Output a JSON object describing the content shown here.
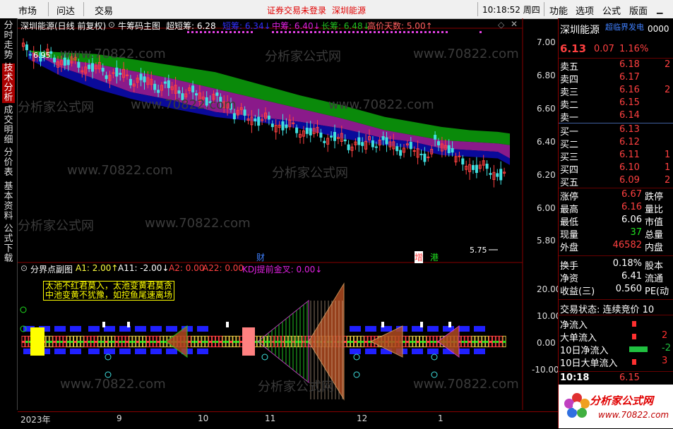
{
  "menubar": {
    "items": [
      "市场",
      "问达",
      "交易"
    ],
    "notice": "证券交易未登录",
    "stock_link": "深圳能源",
    "clock": "10:18:52 周四",
    "right_items": [
      "功能",
      "选项",
      "公式",
      "版面"
    ],
    "icons": [
      "minimize-icon",
      "maximize-icon",
      "close-icon"
    ]
  },
  "left_tabs": [
    {
      "label": "分时走势",
      "active": false
    },
    {
      "label": "技术分析",
      "active": true
    },
    {
      "label": "成交明细",
      "active": false
    },
    {
      "label": "分价表",
      "active": false
    },
    {
      "label": "基本资料",
      "active": false
    },
    {
      "label": "公式下载",
      "active": false
    }
  ],
  "main_chart": {
    "stock_name": "深圳能源(日线 前复权)",
    "indicator": "牛筹码主图",
    "params": [
      {
        "label": "超短筹: 6.28",
        "color": "#ffffff"
      },
      {
        "label": "短筹: 6.34↓",
        "color": "#3030ff"
      },
      {
        "label": "中筹: 6.40↓",
        "color": "#e020e0"
      },
      {
        "label": "长筹: 6.48↓",
        "color": "#20c020"
      },
      {
        "label": "高价天数: 5.00↑",
        "color": "#ff6060"
      }
    ],
    "y_ticks": [
      "7.00",
      "6.80",
      "6.60",
      "6.40",
      "6.20",
      "6.00",
      "5.80"
    ],
    "high_label": "6.95",
    "low_label": "5.75",
    "markers": [
      {
        "label": "财",
        "color": "#4080ff"
      },
      {
        "label": "增",
        "color": "#ff4040"
      },
      {
        "label": "港",
        "color": "#20e020"
      }
    ],
    "watermarks": [
      "分析家公式网",
      "www.70822.com"
    ]
  },
  "sub_chart": {
    "indicator": "分界点副图",
    "params": [
      {
        "label": "A1: 2.00↑",
        "color": "#ffff40"
      },
      {
        "label": "A11: -2.00↓",
        "color": "#ffffff"
      },
      {
        "label": "A2: 0.00",
        "color": "#ff4040"
      },
      {
        "label": "A22: 0.00",
        "color": "#ff4040"
      },
      {
        "label": "KDJ提前金叉: 0.00↓",
        "color": "#e020e0"
      }
    ],
    "note_lines": [
      "太池不红君莫入，太池变黄君莫贪",
      "中池变黄不犹豫，如控鱼尾速离场"
    ],
    "y_ticks": [
      "20.00",
      "10.00",
      "0.00",
      "-10.00"
    ]
  },
  "date_axis": [
    "2023年",
    "9",
    "10",
    "11",
    "12",
    "1"
  ],
  "right_panel": {
    "name": "深圳能源",
    "tag": "超临界发电",
    "code": "0000",
    "price": "6.13",
    "change": "0.07",
    "change_pct": "1.16%",
    "sell": [
      {
        "label": "卖五",
        "price": "6.18",
        "vol": "2"
      },
      {
        "label": "卖四",
        "price": "6.17",
        "vol": ""
      },
      {
        "label": "卖三",
        "price": "6.16",
        "vol": "2"
      },
      {
        "label": "卖二",
        "price": "6.15",
        "vol": ""
      },
      {
        "label": "卖一",
        "price": "6.14",
        "vol": ""
      }
    ],
    "buy": [
      {
        "label": "买一",
        "price": "6.13",
        "vol": ""
      },
      {
        "label": "买二",
        "price": "6.12",
        "vol": ""
      },
      {
        "label": "买三",
        "price": "6.11",
        "vol": "1"
      },
      {
        "label": "买四",
        "price": "6.10",
        "vol": "1"
      },
      {
        "label": "买五",
        "price": "6.09",
        "vol": "2"
      }
    ],
    "stats": [
      {
        "label": "涨停",
        "value": "6.67",
        "color": "#ff4040",
        "label2": "跌停"
      },
      {
        "label": "最高",
        "value": "6.16",
        "color": "#ff4040",
        "label2": "量比"
      },
      {
        "label": "最低",
        "value": "6.06",
        "color": "#ffffff",
        "label2": "市值"
      },
      {
        "label": "现量",
        "value": "37",
        "color": "#20e020",
        "label2": "总量"
      },
      {
        "label": "外盘",
        "value": "46582",
        "color": "#ff4040",
        "label2": "内盘"
      }
    ],
    "stats2": [
      {
        "label": "换手",
        "value": "0.18%",
        "label2": "股本"
      },
      {
        "label": "净资",
        "value": "6.41",
        "label2": "流通"
      },
      {
        "label": "收益(三)",
        "value": "0.560",
        "label2": "PE(动"
      }
    ],
    "trade_status": "交易状态: 连续竞价 10",
    "flows": [
      {
        "label": "净流入",
        "value": "",
        "bar_color": "#ff3030"
      },
      {
        "label": "大单流入",
        "value": "2",
        "bar_color": "#ff3030"
      },
      {
        "label": "10日净流入",
        "value": "-2",
        "bar_color": "#20c040"
      },
      {
        "label": "10日大单流入",
        "value": "3",
        "bar_color": "#ff3030"
      }
    ],
    "tick_time": "10:18",
    "tick_price": "6.15",
    "logo_text": "分析家公式网",
    "logo_url": "www.70822.com"
  },
  "colors": {
    "up": "#ff4040",
    "down": "#40e0e0",
    "panel_border": "#800000"
  }
}
